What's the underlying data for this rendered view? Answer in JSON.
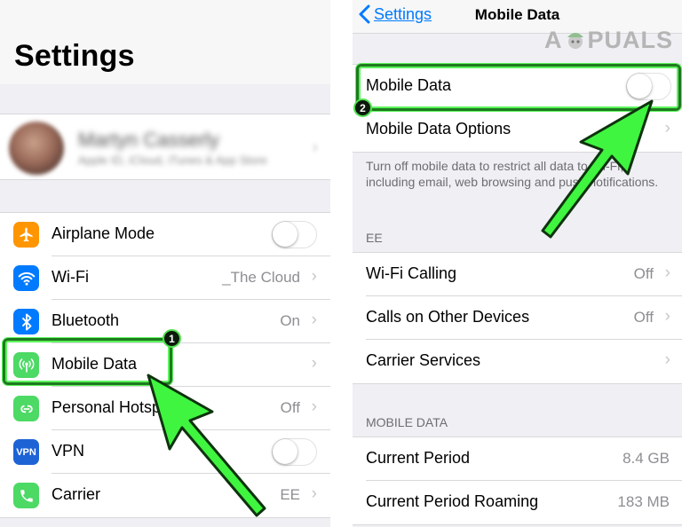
{
  "left": {
    "title": "Settings",
    "profile": {
      "name": "Martyn Casserly",
      "subtitle": "Apple ID, iCloud, iTunes & App Store"
    },
    "rows": [
      {
        "label": "Airplane Mode",
        "value": "",
        "toggle": "off",
        "icon": "airplane-icon",
        "icon_color": "#ff9500"
      },
      {
        "label": "Wi-Fi",
        "value": "_The Cloud",
        "icon": "wifi-icon",
        "icon_color": "#007aff"
      },
      {
        "label": "Bluetooth",
        "value": "On",
        "icon": "bluetooth-icon",
        "icon_color": "#007aff"
      },
      {
        "label": "Mobile Data",
        "value": "",
        "icon": "antenna-icon",
        "icon_color": "#4cd964"
      },
      {
        "label": "Personal Hotspot",
        "value": "Off",
        "icon": "hotspot-icon",
        "icon_color": "#4cd964"
      },
      {
        "label": "VPN",
        "value": "",
        "toggle": "off",
        "icon": "vpn-icon",
        "icon_color": "#1e63d6",
        "icon_text": "VPN"
      },
      {
        "label": "Carrier",
        "value": "EE",
        "icon": "phone-icon",
        "icon_color": "#4cd964"
      }
    ]
  },
  "right": {
    "nav": {
      "back_label": "Settings",
      "title": "Mobile Data"
    },
    "mobile_data_row": {
      "label": "Mobile Data",
      "toggle": "off"
    },
    "mobile_data_options_label": "Mobile Data Options",
    "footnote": "Turn off mobile data to restrict all data to Wi-Fi, including email, web browsing and push notifications.",
    "ee_header": "EE",
    "ee_rows": [
      {
        "label": "Wi-Fi Calling",
        "value": "Off"
      },
      {
        "label": "Calls on Other Devices",
        "value": "Off"
      },
      {
        "label": "Carrier Services",
        "value": ""
      }
    ],
    "usage_header": "MOBILE DATA",
    "usage_rows": [
      {
        "label": "Current Period",
        "value": "8.4 GB"
      },
      {
        "label": "Current Period Roaming",
        "value": "183 MB"
      }
    ]
  },
  "watermark": {
    "prefix": "A",
    "suffix": "PUALS"
  },
  "annotations": {
    "badge_1": "1",
    "badge_2": "2",
    "highlight_color": "#5cf25c",
    "arrow_color": "#3ff53f"
  }
}
